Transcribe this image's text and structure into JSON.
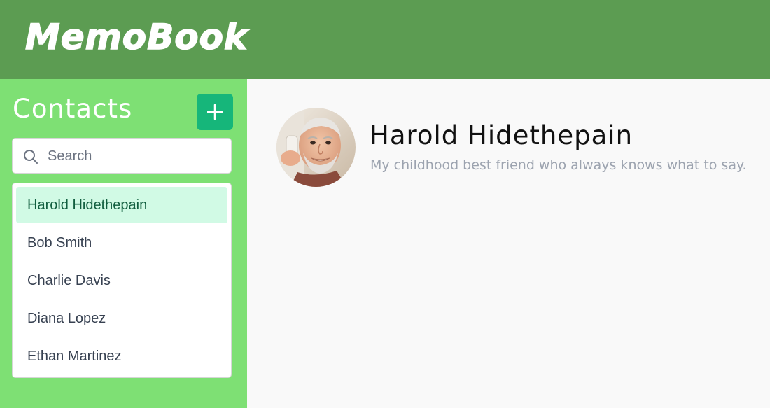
{
  "app": {
    "logo": "MemoBook"
  },
  "sidebar": {
    "title": "Contacts",
    "add_button_icon": "plus-icon",
    "search": {
      "placeholder": "Search",
      "value": "",
      "icon": "search-icon"
    },
    "contacts": [
      {
        "name": "Harold Hidethepain",
        "active": true
      },
      {
        "name": "Bob Smith",
        "active": false
      },
      {
        "name": "Charlie Davis",
        "active": false
      },
      {
        "name": "Diana Lopez",
        "active": false
      },
      {
        "name": "Ethan Martinez",
        "active": false
      }
    ]
  },
  "detail": {
    "name": "Harold Hidethepain",
    "description": "My childhood best friend who always knows what to say.",
    "avatar": "contact-avatar-photo"
  },
  "colors": {
    "header": "#5c9c52",
    "sidebar": "#7ee074",
    "accent": "#16b67a",
    "active_row": "#d1fae5",
    "main_bg": "#f9f9f9"
  }
}
